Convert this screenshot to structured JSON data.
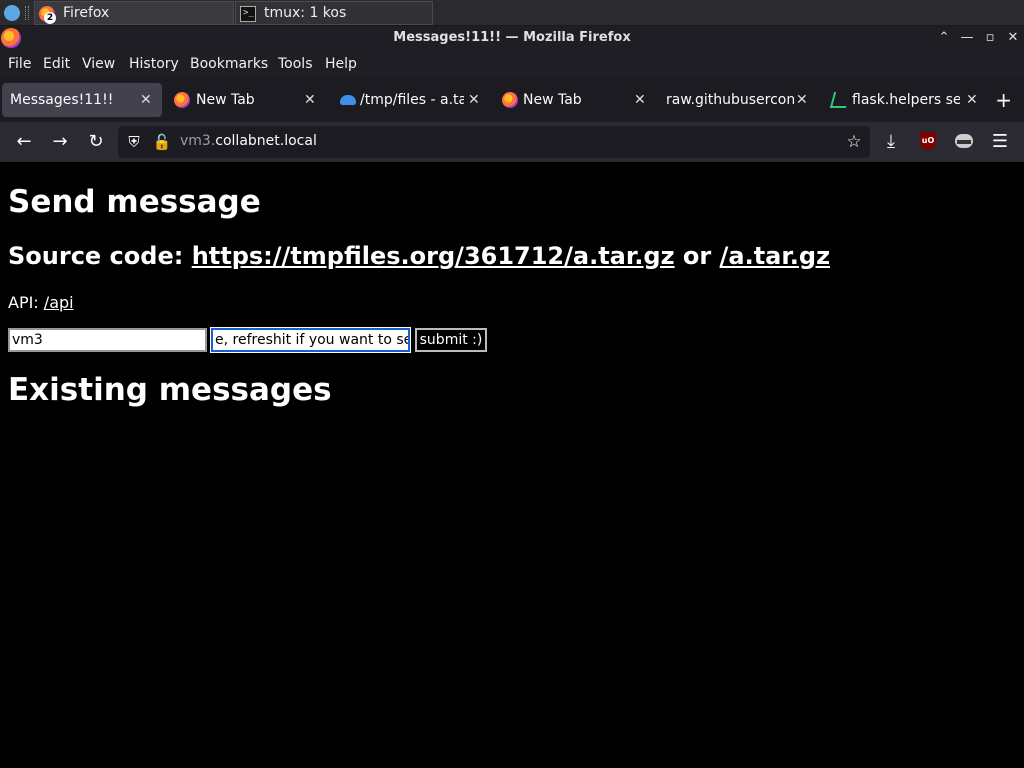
{
  "taskbar": {
    "tasks": [
      {
        "label": "Firefox",
        "badge": "2",
        "icon": "firefox-icon"
      },
      {
        "label": "tmux: 1 kos",
        "icon": "terminal-icon"
      }
    ]
  },
  "window": {
    "title": "Messages!11!! — Mozilla Firefox",
    "controls": [
      "minimize",
      "restore",
      "maximize",
      "close"
    ]
  },
  "menu": {
    "items": [
      "File",
      "Edit",
      "View",
      "History",
      "Bookmarks",
      "Tools",
      "Help"
    ]
  },
  "tabs": [
    {
      "label": "Messages!11!!",
      "active": true,
      "icon": ""
    },
    {
      "label": "New Tab",
      "active": false,
      "icon": "firefox-icon"
    },
    {
      "label": "/tmp/files - a.tar",
      "active": false,
      "icon": "cloud-icon"
    },
    {
      "label": "New Tab",
      "active": false,
      "icon": "firefox-icon"
    },
    {
      "label": "raw.githubuserconte",
      "active": false,
      "icon": ""
    },
    {
      "label": "flask.helpers se",
      "active": false,
      "icon": "flask-icon"
    }
  ],
  "urlbar": {
    "prefix": "vm3.",
    "host": "collabnet.local"
  },
  "page": {
    "heading": "Send message",
    "source_prefix": "Source code: ",
    "source_link1": "https://tmpfiles.org/361712/a.tar.gz",
    "source_or": " or ",
    "source_link2": "/a.tar.gz",
    "api_prefix": "API: ",
    "api_link": "/api",
    "name_value": "vm3",
    "message_value": "e, refreshit if you want to se",
    "submit_label": "submit :)",
    "existing_heading": "Existing messages"
  },
  "colors": {
    "page_bg": "#000000",
    "toolbar_bg": "#2b2a33",
    "tab_active_bg": "#42414d"
  }
}
